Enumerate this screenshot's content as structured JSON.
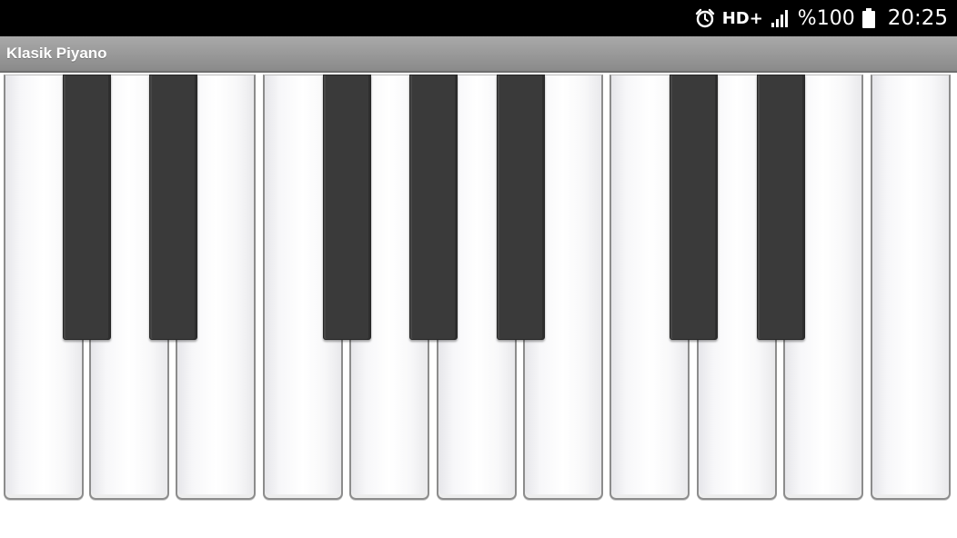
{
  "status_bar": {
    "hd_label": "HD+",
    "battery_text": "%100",
    "time": "20:25",
    "icons": [
      "alarm-icon",
      "signal-icon",
      "battery-icon"
    ]
  },
  "app": {
    "title": "Klasik Piyano"
  },
  "colors": {
    "status_bar_bg": "#000000",
    "title_bar_bg": "#9a9a9a",
    "black_key": "#3a3a3a",
    "white_key": "#ffffff"
  }
}
